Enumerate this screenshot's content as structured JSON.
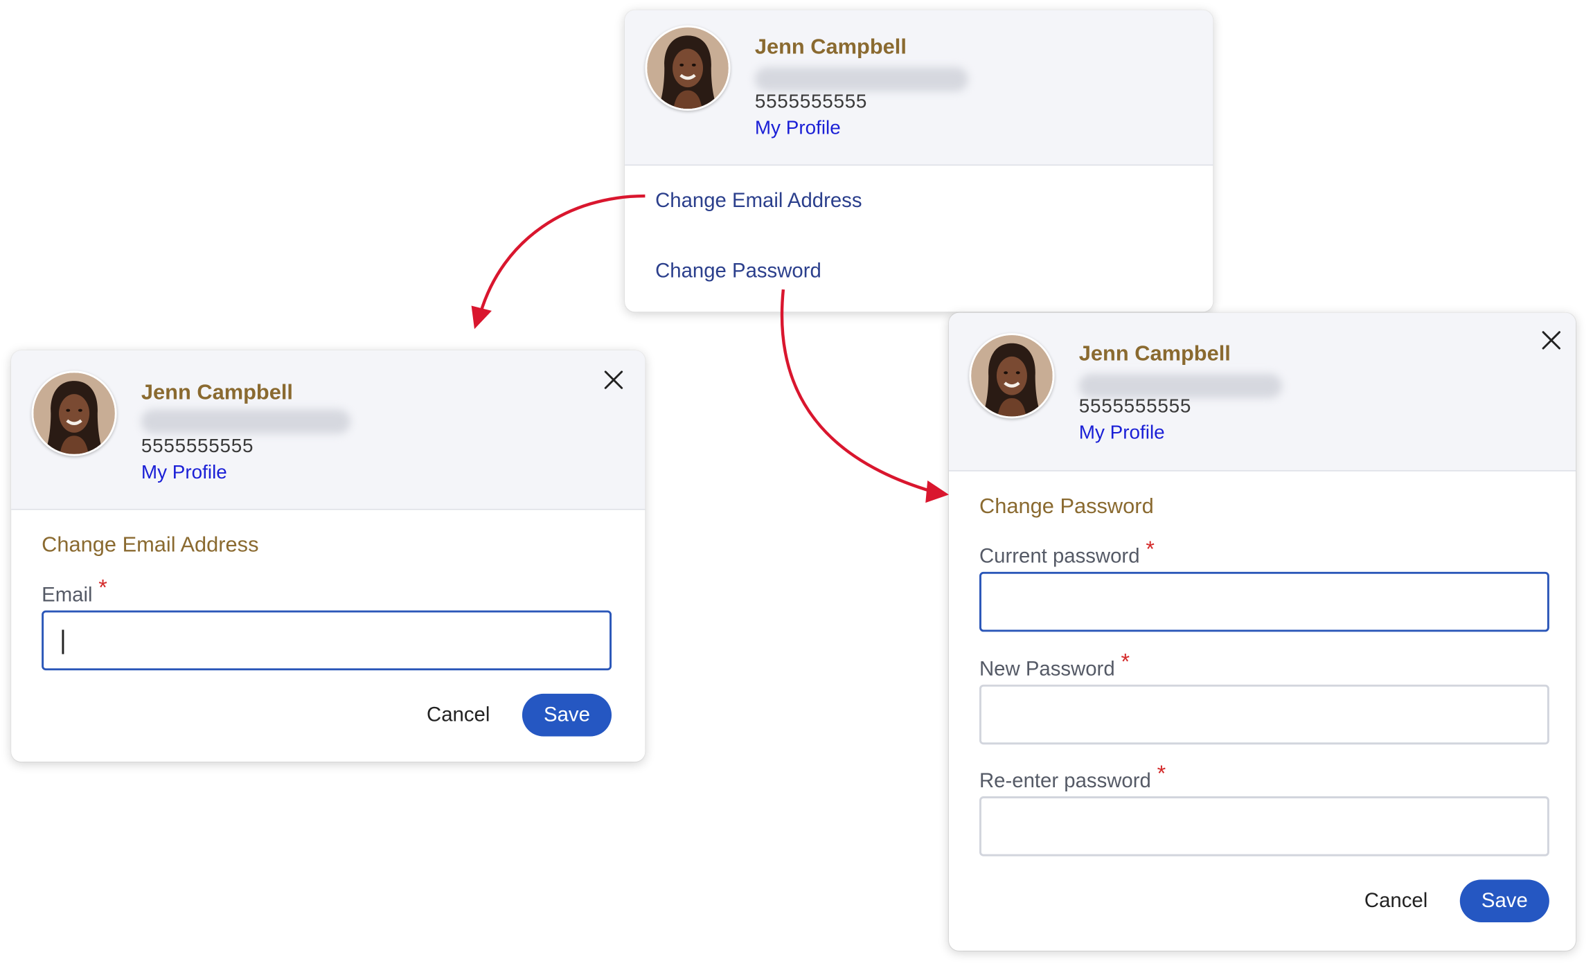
{
  "user": {
    "name": "Jenn Campbell",
    "phone": "5555555555",
    "profile_link": "My Profile"
  },
  "menu": {
    "items": [
      {
        "label": "Change Email Address"
      },
      {
        "label": "Change Password"
      }
    ]
  },
  "email_dialog": {
    "title": "Change Email Address",
    "fields": [
      {
        "label": "Email",
        "required_mark": "*",
        "value": ""
      }
    ],
    "cancel_label": "Cancel",
    "save_label": "Save"
  },
  "password_dialog": {
    "title": "Change Password",
    "fields": [
      {
        "label": "Current password",
        "required_mark": "*",
        "value": ""
      },
      {
        "label": "New Password",
        "required_mark": "*",
        "value": ""
      },
      {
        "label": "Re-enter password",
        "required_mark": "*",
        "value": ""
      }
    ],
    "cancel_label": "Cancel",
    "save_label": "Save"
  },
  "colors": {
    "accent": "#2557c2",
    "arrow": "#d9162e",
    "name": "#8a6a30",
    "link": "#1a1fd6"
  },
  "icons": {
    "close": "close-icon",
    "arrow": "arrow-icon"
  }
}
